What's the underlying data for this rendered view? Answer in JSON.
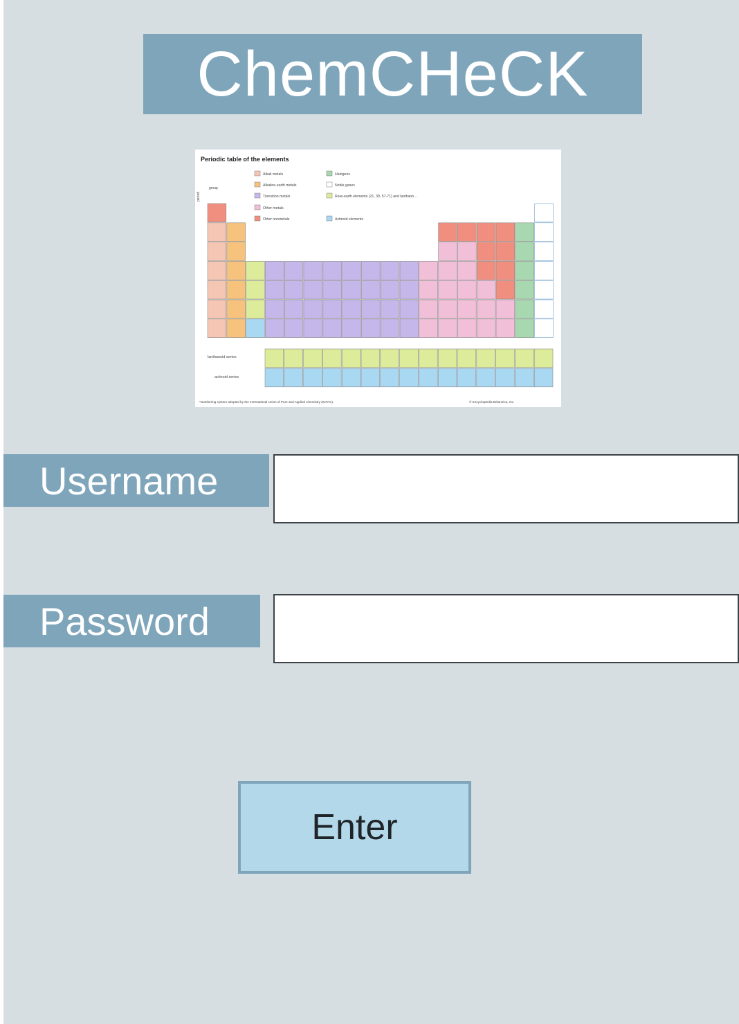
{
  "app": {
    "title": "ChemCHeCK"
  },
  "periodic_table": {
    "title": "Periodic table of the elements",
    "group_label": "group",
    "period_label": "period",
    "legend": [
      {
        "label": "Alkali metals",
        "color": "#f5c6b4"
      },
      {
        "label": "Alkaline-earth metals",
        "color": "#f6c27c"
      },
      {
        "label": "Transition metals",
        "color": "#c6b7ea"
      },
      {
        "label": "Other metals",
        "color": "#f2bfd8"
      },
      {
        "label": "Other nonmetals",
        "color": "#f08f80"
      },
      {
        "label": "Halogens",
        "color": "#a8d8b0"
      },
      {
        "label": "Noble gases",
        "color": "#ffffff"
      },
      {
        "label": "Rare-earth elements (21, 39, 57-71) and lanthanoid elements (57-71 only)",
        "color": "#dcec9a"
      },
      {
        "label": "Actinoid elements",
        "color": "#a9d8f2"
      }
    ],
    "lanthanoid_label": "lanthanoid series",
    "actinoid_label": "actinoid series",
    "footnote": "*Numbering system adopted by the International Union of Pure and Applied Chemistry (IUPAC).",
    "credit": "© Encyclopædia Britannica, Inc."
  },
  "form": {
    "username_label": "Username",
    "username_value": "",
    "password_label": "Password",
    "password_value": "",
    "enter_label": "Enter"
  }
}
